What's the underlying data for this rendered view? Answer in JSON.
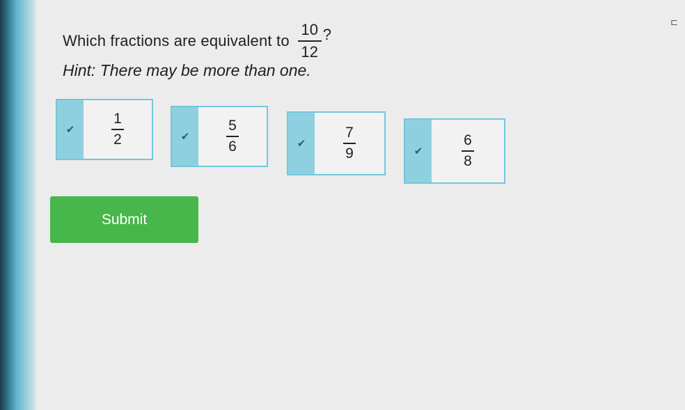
{
  "question": {
    "prefix": "Which fractions are equivalent to",
    "fraction": {
      "numerator": "10",
      "denominator": "12"
    },
    "suffix": "?"
  },
  "hint": "Hint: There may be more than one.",
  "choices": [
    {
      "numerator": "1",
      "denominator": "2",
      "checked": true
    },
    {
      "numerator": "5",
      "denominator": "6",
      "checked": true
    },
    {
      "numerator": "7",
      "denominator": "9",
      "checked": true
    },
    {
      "numerator": "6",
      "denominator": "8",
      "checked": true
    }
  ],
  "check_glyph": "✔",
  "submit_label": "Submit",
  "colors": {
    "accent": "#47b64b",
    "checkbox": "#8fd0e0",
    "border": "#74c6dc"
  }
}
